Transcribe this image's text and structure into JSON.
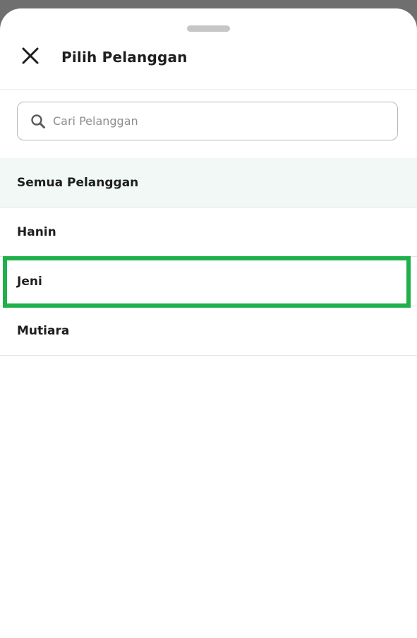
{
  "header": {
    "title": "Pilih Pelanggan",
    "close_icon": "close-icon"
  },
  "search": {
    "placeholder": "Cari Pelanggan",
    "value": "",
    "icon": "search-icon"
  },
  "customers": {
    "items": [
      {
        "label": "Semua Pelanggan",
        "state": "selected"
      },
      {
        "label": "Hanin",
        "state": "normal"
      },
      {
        "label": "Jeni",
        "state": "highlighted"
      },
      {
        "label": "Mutiara",
        "state": "normal"
      }
    ]
  },
  "colors": {
    "selected_background": "#f1f8f5",
    "highlight_border": "#20b04b"
  }
}
